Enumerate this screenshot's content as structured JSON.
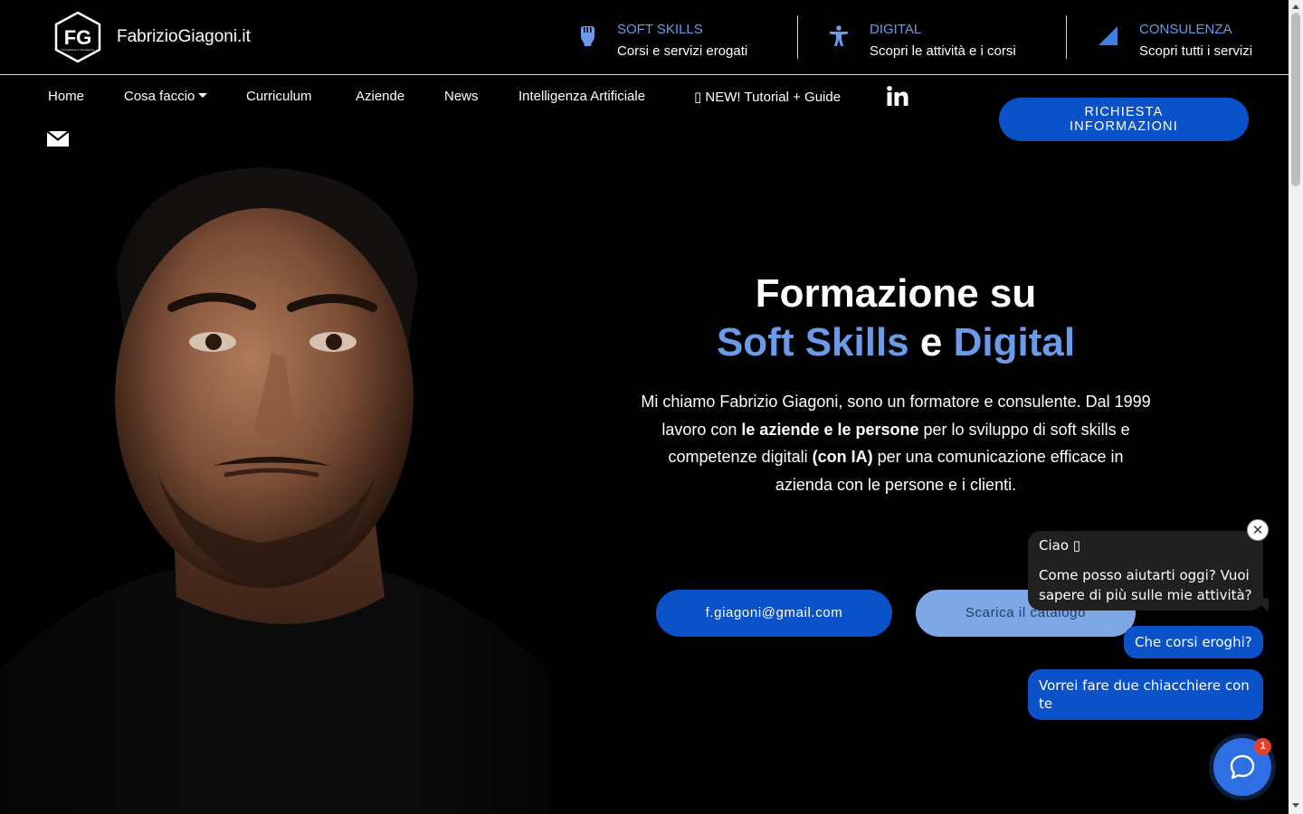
{
  "brand": {
    "name": "FabrizioGiagoni.it",
    "logo_text": "FG",
    "logo_subtext": "Formazione e Consulenza"
  },
  "features": [
    {
      "title": "SOFT SKILLS",
      "subtitle": "Corsi e servizi erogati",
      "icon": "hand-icon"
    },
    {
      "title": "DIGITAL",
      "subtitle": "Scopri le attività e i corsi",
      "icon": "accessibility-icon"
    },
    {
      "title": "CONSULENZA",
      "subtitle": "Scopri tutti i servizi",
      "icon": "triangle-icon"
    }
  ],
  "nav": {
    "home": "Home",
    "cosa_faccio": "Cosa faccio",
    "curriculum": "Curriculum",
    "aziende": "Aziende",
    "news": "News",
    "ia": "Intelligenza Artificiale",
    "tutorial": "▯ NEW! Tutorial + Guide",
    "cta_line1": "RICHIESTA",
    "cta_line2": "INFORMAZIONI"
  },
  "hero": {
    "title_line1": "Formazione su",
    "title_accent1": "Soft Skills",
    "title_conj": "e",
    "title_accent2": "Digital",
    "desc_part1": "Mi chiamo Fabrizio Giagoni, sono un formatore e consulente. Dal 1999 lavoro con",
    "desc_bold1": "le aziende e le persone",
    "desc_part2": "per lo sviluppo di soft skills e competenze digitali",
    "desc_bold2": "(con IA)",
    "desc_part3": "per una comunicazione efficace in azienda con le persone e i clienti.",
    "email_button": "f.giagoni@gmail.com",
    "catalog_button": "Scarica il catalogo"
  },
  "chat": {
    "greeting": "Ciao ▯",
    "message": "Come posso aiutarti oggi? Vuoi sapere di più sulle mie attività?",
    "close": "✕",
    "quick_reply_1": "Che corsi eroghi?",
    "quick_reply_2": "Vorrei fare due chiacchiere con te",
    "badge": "1"
  },
  "colors": {
    "accent": "#6b9be8",
    "primary_button": "#0b52c8",
    "secondary_button": "#7ea7e6",
    "chat_launcher": "#2f6fe4",
    "badge": "#e2412a"
  }
}
